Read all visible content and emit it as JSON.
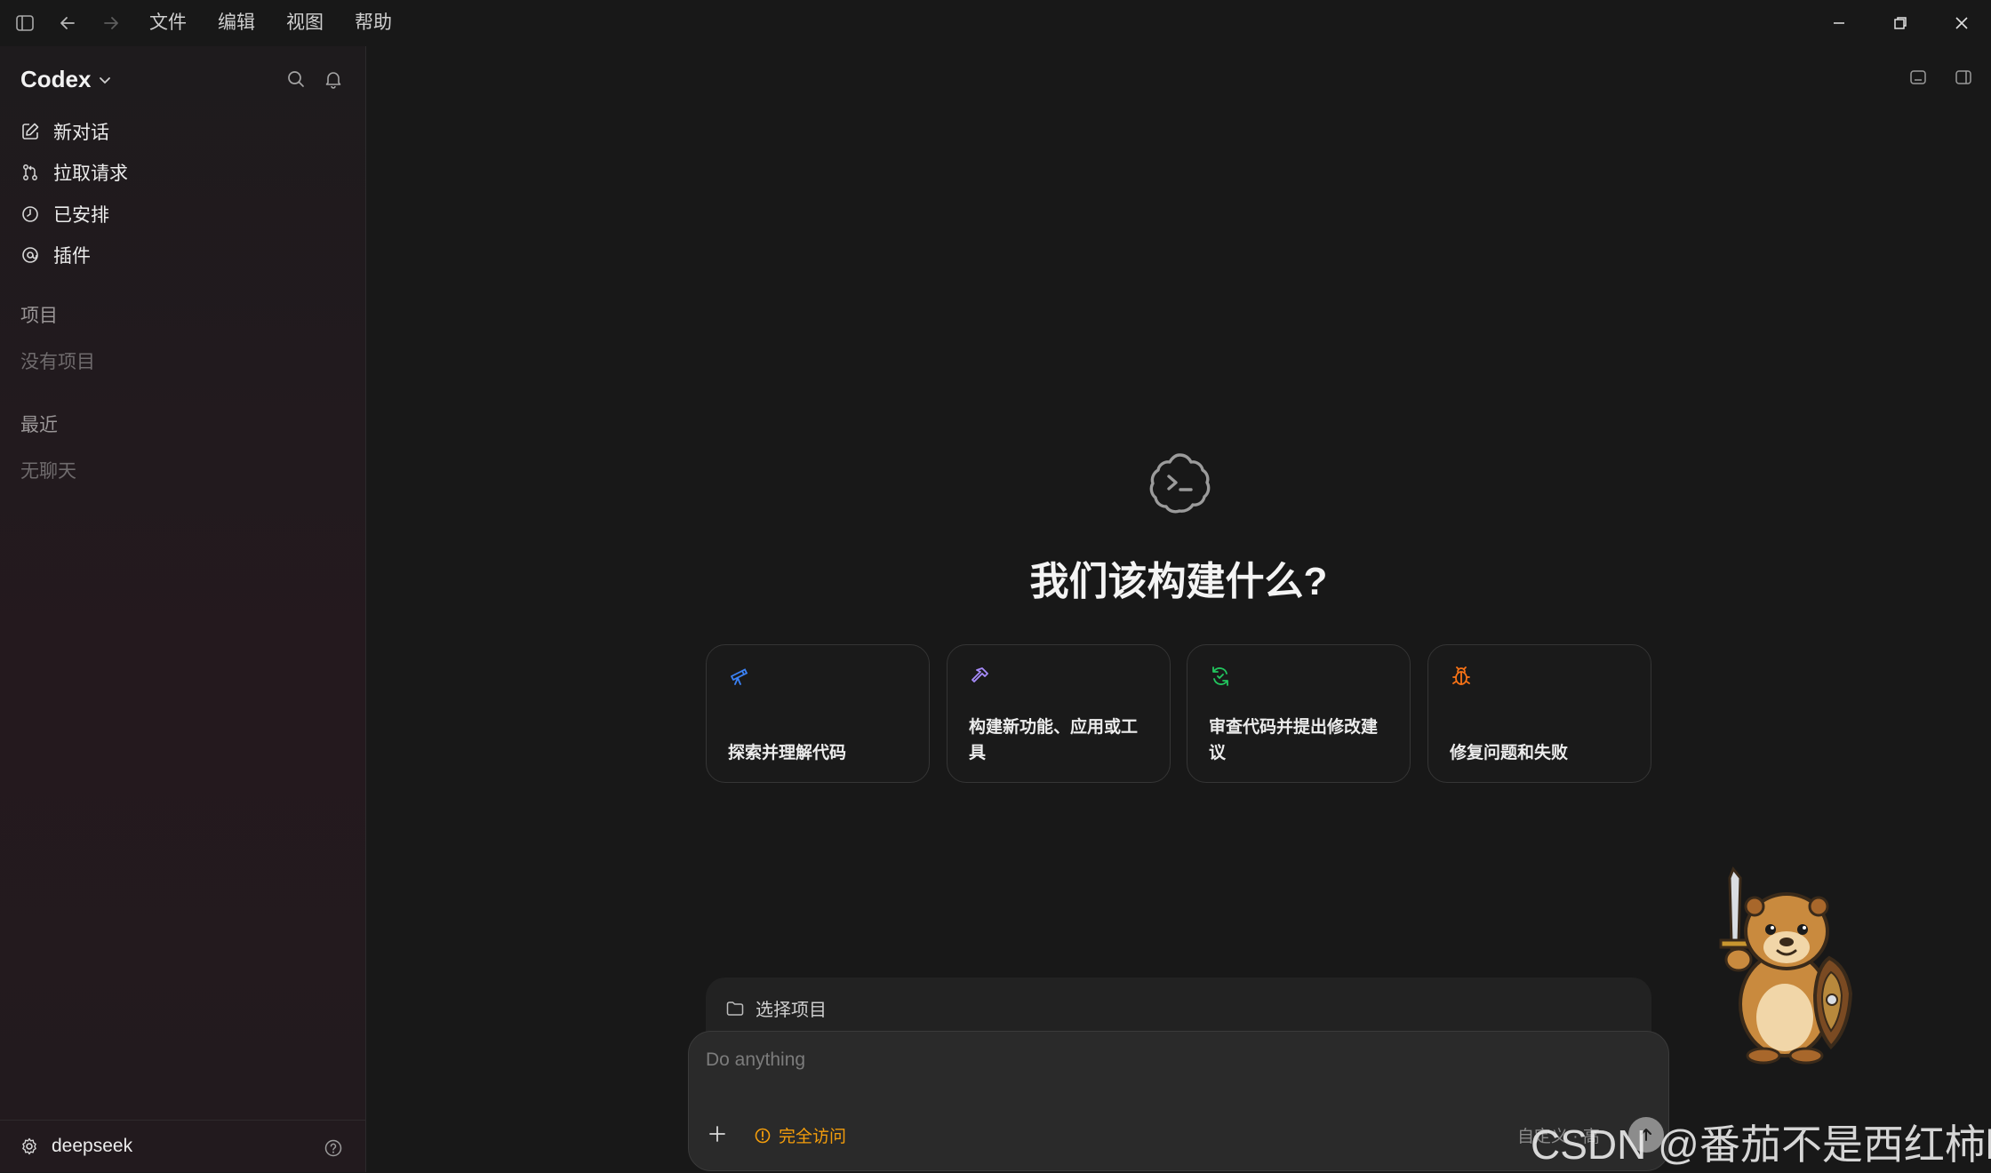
{
  "titlebar": {
    "menu": [
      "文件",
      "编辑",
      "视图",
      "帮助"
    ]
  },
  "sidebar": {
    "brand": "Codex",
    "nav": [
      {
        "label": "新对话",
        "icon": "edit-icon"
      },
      {
        "label": "拉取请求",
        "icon": "pull-request-icon"
      },
      {
        "label": "已安排",
        "icon": "clock-icon"
      },
      {
        "label": "插件",
        "icon": "plugin-icon"
      }
    ],
    "projects_heading": "项目",
    "projects_empty": "没有项目",
    "recent_heading": "最近",
    "recent_empty": "无聊天",
    "user": "deepseek"
  },
  "main": {
    "title": "我们该构建什么?",
    "cards": [
      {
        "label": "探索并理解代码",
        "icon": "telescope-icon",
        "color": "#3b82f6"
      },
      {
        "label": "构建新功能、应用或工具",
        "icon": "hammer-icon",
        "color": "#a78bfa"
      },
      {
        "label": "审查代码并提出修改建议",
        "icon": "refresh-icon",
        "color": "#22c55e"
      },
      {
        "label": "修复问题和失败",
        "icon": "bug-icon",
        "color": "#f97316"
      }
    ],
    "project_select": "选择项目",
    "composer": {
      "placeholder": "Do anything",
      "access_label": "完全访问",
      "access_color": "#f59e0b",
      "right_text": "自定义 · 高"
    }
  },
  "watermark": "CSDN @番茄不是西红柿kk"
}
